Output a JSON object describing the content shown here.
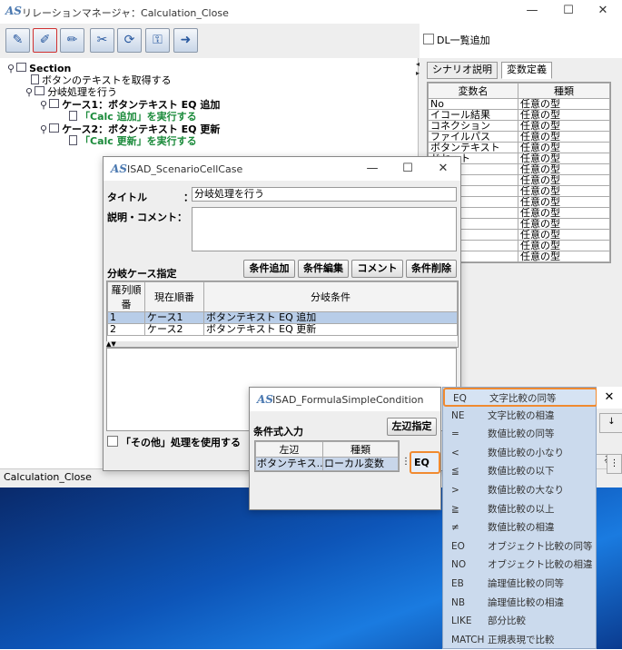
{
  "main_window": {
    "title": "リレーションマネージャ：Calculation_Close",
    "logo": "AS",
    "minimize": "—",
    "maximize": "☐",
    "close": "✕",
    "dl_checkbox_label": "DL一覧追加",
    "status_text": "Calculation_Close",
    "toolbar_icons": [
      "pencil-icon",
      "edit-icon",
      "brush-icon",
      "tools-icon",
      "refresh-icon",
      "key-icon",
      "export-icon"
    ]
  },
  "tree": {
    "section": "Section",
    "n1": "ボタンのテキストを取得する",
    "n2": "分岐処理を行う",
    "n3": "ケース1：ボタンテキスト EQ 追加",
    "n4": "「Calc 追加」を実行する",
    "n5": "ケース2：ボタンテキスト EQ 更新",
    "n6": "「Calc 更新」を実行する"
  },
  "right_panel": {
    "tab1": "シナリオ説明",
    "tab2": "変数定義",
    "col_name": "変数名",
    "col_type": "種類",
    "rows": [
      {
        "name": "No",
        "type": "任意の型"
      },
      {
        "name": "イコール結果",
        "type": "任意の型"
      },
      {
        "name": "コネクション",
        "type": "任意の型"
      },
      {
        "name": "ファイルパス",
        "type": "任意の型"
      },
      {
        "name": "ボタンテキスト",
        "type": "任意の型"
      },
      {
        "name": "ドセット",
        "type": "任意の型"
      },
      {
        "name": "ップ",
        "type": "任意の型"
      },
      {
        "name": "",
        "type": "任意の型"
      },
      {
        "name": "",
        "type": "任意の型"
      },
      {
        "name": "",
        "type": "任意の型"
      },
      {
        "name": "",
        "type": "任意の型"
      },
      {
        "name": "",
        "type": "任意の型"
      },
      {
        "name": "ル",
        "type": "任意の型"
      },
      {
        "name": "指",
        "type": "任意の型"
      },
      {
        "name": "果",
        "type": "任意の型"
      }
    ],
    "partial_button": "る"
  },
  "case_dialog": {
    "title": "ISAD_ScenarioCellCase",
    "title_label": "タイトル",
    "colon": "：",
    "title_value": "分岐処理を行う",
    "comment_label": "説明・コメント：",
    "branch_label": "分岐ケース指定",
    "btn_add": "条件追加",
    "btn_edit": "条件編集",
    "btn_comment": "コメント",
    "btn_delete": "条件削除",
    "col_order": "羅列順番",
    "col_current": "現在順番",
    "col_condition": "分岐条件",
    "rows": [
      {
        "order": "1",
        "current": "ケース1",
        "cond": "ボタンテキスト EQ 追加"
      },
      {
        "order": "2",
        "current": "ケース2",
        "cond": "ボタンテキスト EQ 更新"
      }
    ],
    "other_checkbox": "「その他」処理を使用する"
  },
  "formula_dialog": {
    "title": "ISAD_FormulaSimpleCondition",
    "input_label": "条件式入力",
    "btn_left": "左辺指定",
    "col_left": "左辺",
    "col_type": "種類",
    "left_value": "ボタンテキス...",
    "type_value": "ローカル変数",
    "operator": "EQ"
  },
  "operator_list": [
    {
      "code": "EQ",
      "desc": "文字比較の同等"
    },
    {
      "code": "NE",
      "desc": "文字比較の相違"
    },
    {
      "code": "=",
      "desc": "数値比較の同等"
    },
    {
      "code": "<",
      "desc": "数値比較の小なり"
    },
    {
      "code": "≦",
      "desc": "数値比較の以下"
    },
    {
      "code": ">",
      "desc": "数値比較の大なり"
    },
    {
      "code": "≧",
      "desc": "数値比較の以上"
    },
    {
      "code": "≠",
      "desc": "数値比較の相違"
    },
    {
      "code": "EO",
      "desc": "オブジェクト比較の同等"
    },
    {
      "code": "NO",
      "desc": "オブジェクト比較の相違"
    },
    {
      "code": "EB",
      "desc": "論理値比較の同等"
    },
    {
      "code": "NB",
      "desc": "論理値比較の相違"
    },
    {
      "code": "LIKE",
      "desc": "部分比較"
    },
    {
      "code": "MATCH",
      "desc": "正規表現で比較"
    }
  ]
}
